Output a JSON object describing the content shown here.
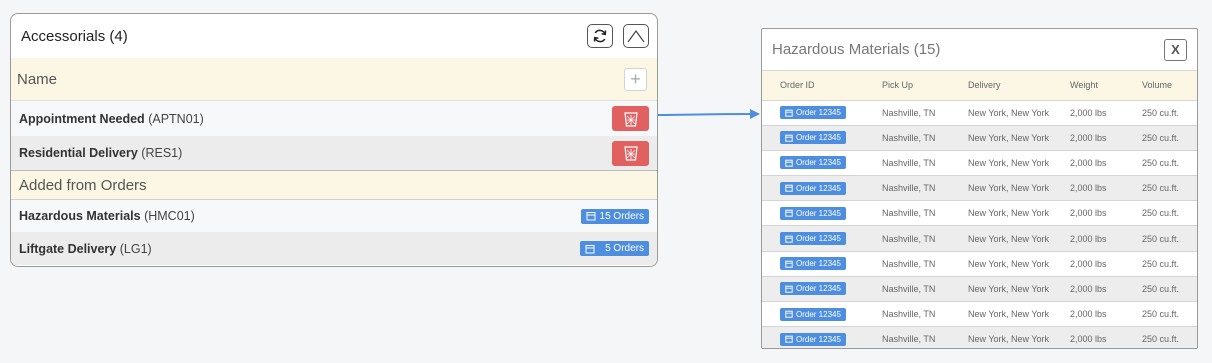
{
  "accessorials": {
    "title": "Accessorials (4)",
    "name_header": "Name",
    "add_label": "+",
    "items": [
      {
        "name": "Appointment Needed",
        "code": "(APTN01)"
      },
      {
        "name": "Residential Delivery",
        "code": "(RES1)"
      }
    ],
    "added_header": "Added from Orders",
    "added_items": [
      {
        "name": "Hazardous Materials",
        "code": "(HMC01)",
        "badge": "15 Orders"
      },
      {
        "name": "Liftgate Delivery",
        "code": "(LG1)",
        "badge": "5 Orders"
      }
    ]
  },
  "hazardous": {
    "title": "Hazardous Materials (15)",
    "close_label": "X",
    "columns": [
      "Order ID",
      "Pick Up",
      "Delivery",
      "Weight",
      "Volume"
    ],
    "rows": [
      {
        "order": "Order 12345",
        "pickup": "Nashville, TN",
        "delivery": "New York, New York",
        "weight": "2,000 lbs",
        "volume": "250 cu.ft."
      },
      {
        "order": "Order 12345",
        "pickup": "Nashville, TN",
        "delivery": "New York, New York",
        "weight": "2,000 lbs",
        "volume": "250 cu.ft."
      },
      {
        "order": "Order 12345",
        "pickup": "Nashville, TN",
        "delivery": "New York, New York",
        "weight": "2,000 lbs",
        "volume": "250 cu.ft."
      },
      {
        "order": "Order 12345",
        "pickup": "Nashville, TN",
        "delivery": "New York, New York",
        "weight": "2,000 lbs",
        "volume": "250 cu.ft."
      },
      {
        "order": "Order 12345",
        "pickup": "Nashville, TN",
        "delivery": "New York, New York",
        "weight": "2,000 lbs",
        "volume": "250 cu.ft."
      },
      {
        "order": "Order 12345",
        "pickup": "Nashville, TN",
        "delivery": "New York, New York",
        "weight": "2,000 lbs",
        "volume": "250 cu.ft."
      },
      {
        "order": "Order 12345",
        "pickup": "Nashville, TN",
        "delivery": "New York, New York",
        "weight": "2,000 lbs",
        "volume": "250 cu.ft."
      },
      {
        "order": "Order 12345",
        "pickup": "Nashville, TN",
        "delivery": "New York, New York",
        "weight": "2,000 lbs",
        "volume": "250 cu.ft."
      },
      {
        "order": "Order 12345",
        "pickup": "Nashville, TN",
        "delivery": "New York, New York",
        "weight": "2,000 lbs",
        "volume": "250 cu.ft."
      },
      {
        "order": "Order 12345",
        "pickup": "Nashville, TN",
        "delivery": "New York, New York",
        "weight": "2,000 lbs",
        "volume": "250 cu.ft."
      }
    ]
  },
  "colors": {
    "badge": "#4e8ee0",
    "delete": "#e06160",
    "section_bg": "#fbf7e4",
    "connector": "#4e8ee0"
  },
  "icons": {
    "refresh": "refresh-icon",
    "collapse": "chevron-up-icon",
    "delete": "trash-icon",
    "calendar": "calendar-icon",
    "close": "close-icon"
  }
}
